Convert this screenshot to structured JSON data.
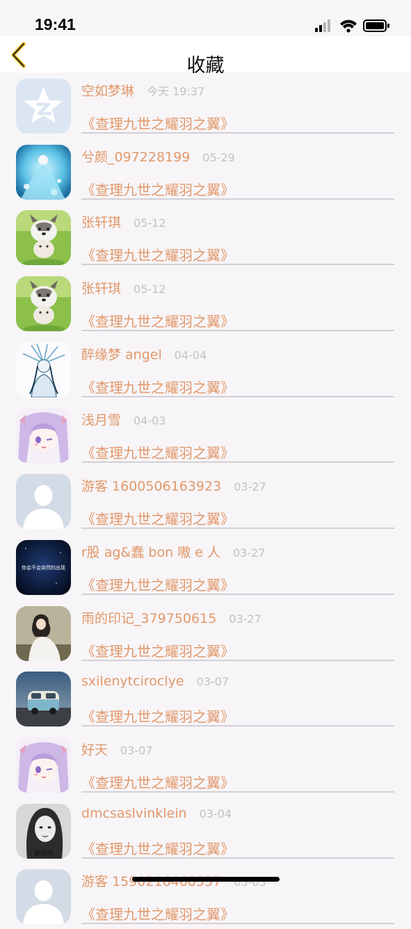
{
  "status_bar": {
    "time": "19:41"
  },
  "nav": {
    "title": "收藏"
  },
  "colors": {
    "accent": "#e2986a",
    "date": "#c2c2c2",
    "back": "#e8c02c"
  },
  "items": [
    {
      "name": "空如梦琳",
      "date": "今天 19:37",
      "book": "《查理九世之耀羽之翼》",
      "avatar": "qzone-default-icon"
    },
    {
      "name": "兮颜_097228199",
      "date": "05-29",
      "book": "《查理九世之耀羽之翼》",
      "avatar": "anime-blue-girl"
    },
    {
      "name": "张轩琪",
      "date": "05-12",
      "book": "《查理九世之耀羽之翼》",
      "avatar": "puppy-photo"
    },
    {
      "name": "张轩琪",
      "date": "05-12",
      "book": "《查理九世之耀羽之翼》",
      "avatar": "puppy-photo"
    },
    {
      "name": "醉缘梦 angel",
      "date": "04-04",
      "book": "《查理九世之耀羽之翼》",
      "avatar": "sketch-girl"
    },
    {
      "name": "浅月雪",
      "date": "04-03",
      "book": "《查理九世之耀羽之翼》",
      "avatar": "anime-purple-girl"
    },
    {
      "name": "游客 1600506163923",
      "date": "03-27",
      "book": "《查理九世之耀羽之翼》",
      "avatar": "default-person-icon"
    },
    {
      "name": "r股 ag&蠢 bon 嗷 e 人",
      "date": "03-27",
      "book": "《查理九世之耀羽之翼》",
      "avatar": "dark-text-image",
      "avatar_text": "你会不会突然的出现"
    },
    {
      "name": "雨的印记_379750615",
      "date": "03-27",
      "book": "《查理九世之耀羽之翼》",
      "avatar": "girl-photo"
    },
    {
      "name": "sxilenytciroclye",
      "date": "03-07",
      "book": "《查理九世之耀羽之翼》",
      "avatar": "van-photo"
    },
    {
      "name": "好天",
      "date": "03-07",
      "book": "《查理九世之耀羽之翼》",
      "avatar": "anime-purple-girl"
    },
    {
      "name": "dmcsaslvinklein",
      "date": "03-04",
      "book": "《查理九世之耀羽之翼》",
      "avatar": "bw-girl-photo",
      "avatar_text": "爱我吗"
    },
    {
      "name": "游客 1590216460557",
      "date": "03-03",
      "book": "《查理九世之耀羽之翼》",
      "avatar": "default-person-icon"
    }
  ]
}
